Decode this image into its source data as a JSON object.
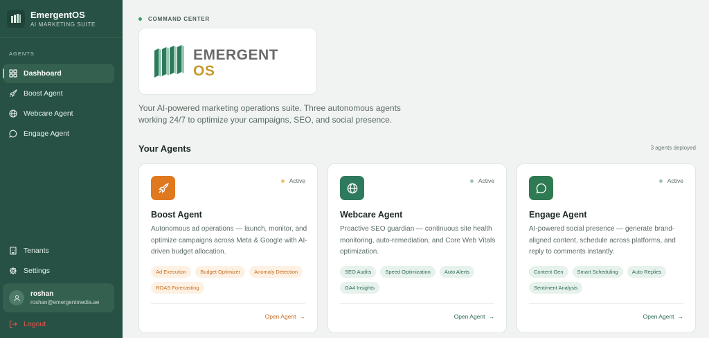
{
  "brand": {
    "name": "EmergentOS",
    "subtitle": "AI MARKETING SUITE"
  },
  "sidebar": {
    "section_label": "AGENTS",
    "items": [
      {
        "label": "Dashboard",
        "icon": "grid-icon"
      },
      {
        "label": "Boost Agent",
        "icon": "rocket-icon"
      },
      {
        "label": "Webcare Agent",
        "icon": "globe-icon"
      },
      {
        "label": "Engage Agent",
        "icon": "chat-icon"
      }
    ],
    "bottom_items": [
      {
        "label": "Tenants",
        "icon": "building-icon"
      },
      {
        "label": "Settings",
        "icon": "gear-icon"
      }
    ],
    "user": {
      "name": "roshan",
      "email": "roshan@emergentmedia.ae"
    },
    "logout_label": "Logout"
  },
  "main": {
    "section_label": "COMMAND CENTER",
    "hero": {
      "word1": "EMERGENT",
      "word2": "OS"
    },
    "description": "Your AI-powered marketing operations suite. Three autonomous agents working 24/7 to optimize your campaigns, SEO, and social presence.",
    "agents_title": "Your Agents",
    "agents_count": "3 agents deployed",
    "cards": [
      {
        "title": "Boost Agent",
        "status": "Active",
        "description": "Autonomous ad operations — launch, monitor, and optimize campaigns across Meta & Google with AI-driven budget allocation.",
        "tags": [
          "Ad Execution",
          "Budget Optimizer",
          "Anomaly Detection",
          "ROAS Forecasting"
        ],
        "link": "Open Agent",
        "icon": "rocket-icon"
      },
      {
        "title": "Webcare Agent",
        "status": "Active",
        "description": "Proactive SEO guardian — continuous site health monitoring, auto-remediation, and Core Web Vitals optimization.",
        "tags": [
          "SEO Audits",
          "Speed Optimization",
          "Auto Alerts",
          "GA4 Insights"
        ],
        "link": "Open Agent",
        "icon": "globe-icon"
      },
      {
        "title": "Engage Agent",
        "status": "Active",
        "description": "AI-powered social presence — generate brand-aligned content, schedule across platforms, and reply to comments instantly.",
        "tags": [
          "Content Gen",
          "Smart Scheduling",
          "Auto Replies",
          "Sentiment Analysis"
        ],
        "link": "Open Agent",
        "icon": "chat-icon"
      }
    ]
  },
  "colors": {
    "sidebar_bg": "#275144",
    "accent_green": "#2e6b52",
    "accent_orange": "#e0781f",
    "logo_gold": "#c69a2a",
    "logout_red": "#e05a4f"
  }
}
